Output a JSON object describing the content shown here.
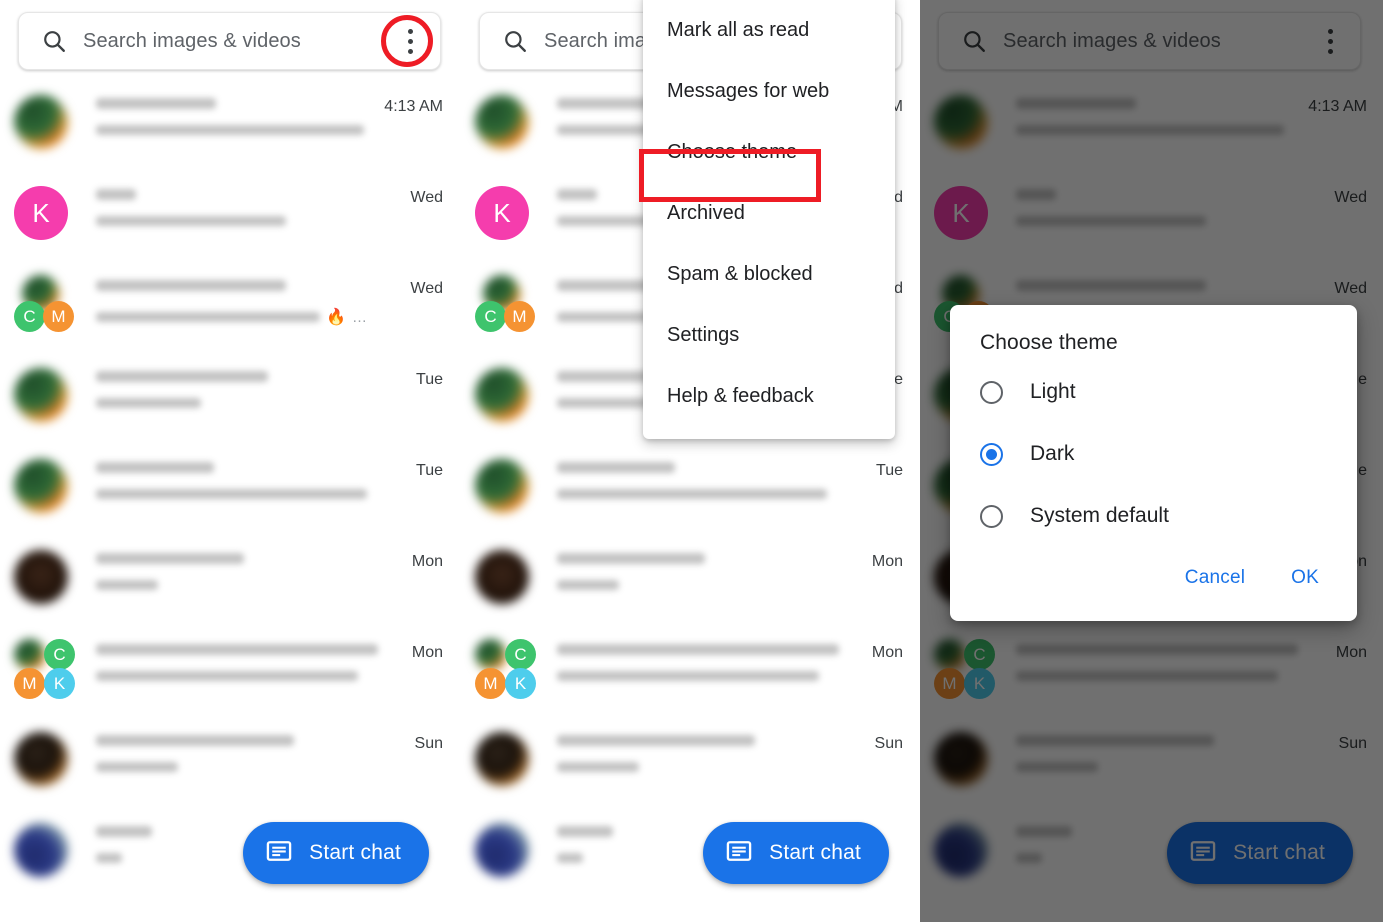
{
  "app": {
    "search": {
      "placeholder": "Search images & videos",
      "placeholder_truncated": "Search ima",
      "search_icon": "search-icon",
      "overflow_icon": "more-vert-icon"
    },
    "fab": {
      "label": "Start chat",
      "icon": "new-message-icon",
      "color": "#1a73e8"
    },
    "conversations": [
      {
        "time": "4:13 AM",
        "title_w": 120,
        "sub_w": 268,
        "avatar": "photo-multi",
        "badges": []
      },
      {
        "time": "Wed",
        "title_w": 40,
        "sub_w": 190,
        "avatar": "letter",
        "letter": "K",
        "letter_color": "#f53dad",
        "badges": []
      },
      {
        "time": "Wed",
        "title_w": 190,
        "sub_w": 240,
        "avatar": "photo-multi",
        "badges": [
          {
            "letter": "C",
            "color": "#3ec46d"
          },
          {
            "letter": "M",
            "color": "#f59332"
          }
        ],
        "emoji": "🔥",
        "trailing": "…"
      },
      {
        "time": "Tue",
        "title_w": 172,
        "sub_w": 105,
        "avatar": "photo-multi",
        "badges": []
      },
      {
        "time": "Tue",
        "title_w": 118,
        "sub_w": 282,
        "avatar": "photo-multi",
        "badges": []
      },
      {
        "time": "Mon",
        "title_w": 148,
        "sub_w": 62,
        "avatar": "photo-dark",
        "badges": []
      },
      {
        "time": "Mon",
        "title_w": 282,
        "sub_w": 262,
        "avatar": "photo-multi",
        "badges": [
          {
            "letter": "C",
            "color": "#3ec46d"
          },
          {
            "letter": "M",
            "color": "#f59332"
          },
          {
            "letter": "K",
            "color": "#4ecdec"
          }
        ]
      },
      {
        "time": "Sun",
        "title_w": 198,
        "sub_w": 82,
        "avatar": "photo-warm",
        "badges": []
      },
      {
        "time": "",
        "title_w": 56,
        "sub_w": 26,
        "avatar": "photo-cool",
        "badges": []
      }
    ]
  },
  "overflow_menu": {
    "items": [
      {
        "label": "Mark all as read",
        "highlighted": false
      },
      {
        "label": "Messages for web",
        "highlighted": false
      },
      {
        "label": "Choose theme",
        "highlighted": true
      },
      {
        "label": "Archived",
        "highlighted": false
      },
      {
        "label": "Spam & blocked",
        "highlighted": false
      },
      {
        "label": "Settings",
        "highlighted": false
      },
      {
        "label": "Help & feedback",
        "highlighted": false
      }
    ],
    "highlight_color": "#ee1c25"
  },
  "theme_dialog": {
    "title": "Choose theme",
    "options": [
      {
        "label": "Light",
        "selected": false
      },
      {
        "label": "Dark",
        "selected": true
      },
      {
        "label": "System default",
        "selected": false
      }
    ],
    "cancel_label": "Cancel",
    "ok_label": "OK",
    "accent_color": "#1a73e8"
  },
  "annotation": {
    "step1_target": "overflow-menu-button",
    "step2_target": "menu-item-choose-theme",
    "highlight_color": "#ee1c25"
  }
}
